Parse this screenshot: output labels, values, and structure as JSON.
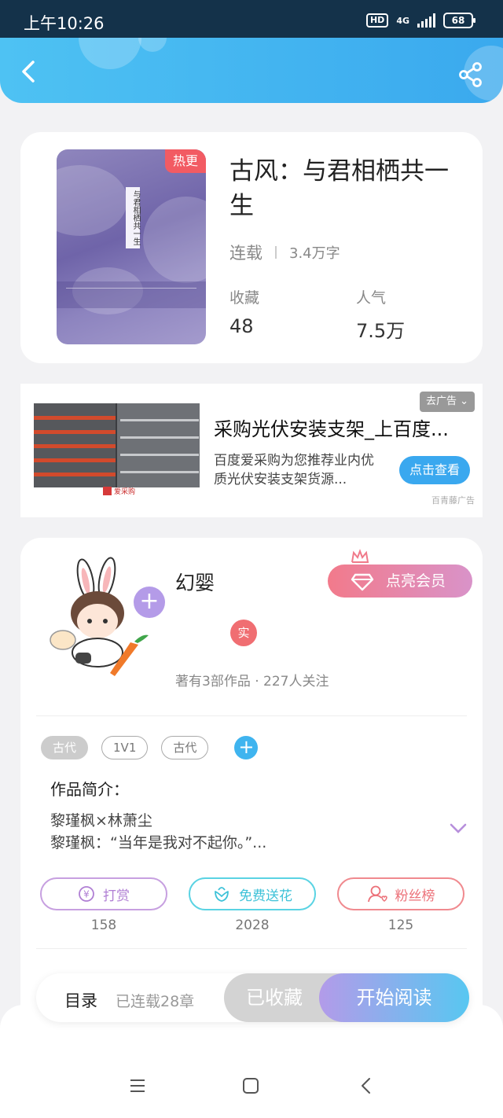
{
  "status_bar": {
    "time": "上午10:26",
    "hd": "HD",
    "network": "4G",
    "battery": "68"
  },
  "book": {
    "badge": "热更",
    "cover_title": "与君相栖共一生",
    "title": "古风：与君相栖共一生",
    "status": "连载",
    "word_count": "3.4万字",
    "favorites_label": "收藏",
    "favorites_value": "48",
    "popularity_label": "人气",
    "popularity_value": "7.5万"
  },
  "ad": {
    "close_label": "去广告",
    "title": "采购光伏安装支架_上百度...",
    "description": "百度爱采购为您推荐业内优质光伏安装支架货源...",
    "cta": "点击查看",
    "source": "百青藤广告",
    "brand": "爱采购"
  },
  "author": {
    "name": "幻婴",
    "vip_label": "点亮会员",
    "verified_badge": "实",
    "stats": "著有3部作品 · 227人关注"
  },
  "tags": [
    "古代",
    "1V1",
    "古代"
  ],
  "intro": {
    "heading": "作品简介：",
    "line1": "黎瑾枫×林萧尘",
    "line2": "黎瑾枫：“当年是我对不起你。”..."
  },
  "actions": [
    {
      "label": "打赏",
      "count": "158",
      "icon": "yen-coin-icon"
    },
    {
      "label": "免费送花",
      "count": "2028",
      "icon": "flower-icon"
    },
    {
      "label": "粉丝榜",
      "count": "125",
      "icon": "fan-ranking-icon"
    }
  ],
  "bottom_bar": {
    "toc_label": "目录",
    "chapters": "已连载28章",
    "favorited_label": "已收藏",
    "start_label": "开始阅读"
  },
  "colors": {
    "header_blue": "#3aa9ee",
    "hot_badge": "#f25b63",
    "vip_gradient_start": "#f27a8b",
    "start_gradient_end": "#58c7f1"
  }
}
